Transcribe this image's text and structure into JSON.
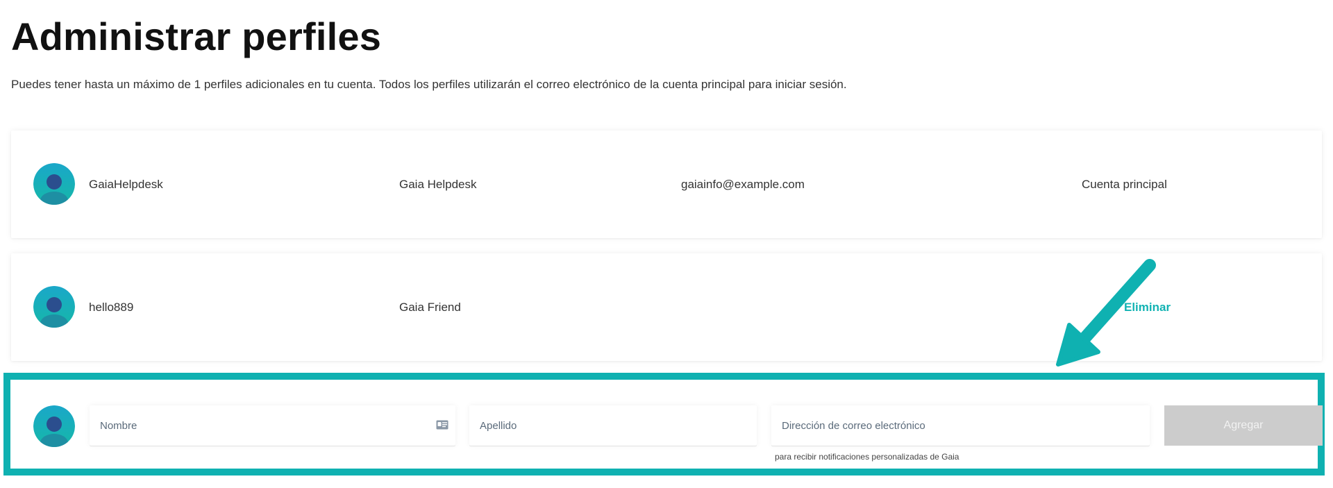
{
  "page": {
    "title": "Administrar perfiles",
    "subtitle": "Puedes tener hasta un máximo de 1 perfiles adicionales en tu cuenta. Todos los perfiles utilizarán el correo electrónico de la cuenta principal para iniciar sesión."
  },
  "profiles": [
    {
      "username": "GaiaHelpdesk",
      "display_name": "Gaia Helpdesk",
      "email": "gaiainfo@example.com",
      "status": "Cuenta principal"
    },
    {
      "username": "hello889",
      "display_name": "Gaia Friend",
      "email": "",
      "action_label": "Eliminar"
    }
  ],
  "add_profile": {
    "first_name_placeholder": "Nombre",
    "first_name_value": "",
    "last_name_placeholder": "Apellido",
    "last_name_value": "",
    "email_placeholder": "Dirección de correo electrónico",
    "email_value": "",
    "email_hint": "para recibir notificaciones personalizadas de Gaia",
    "add_button_label": "Agregar",
    "contact_card_icon": "contact-card-icon"
  },
  "colors": {
    "accent": "#0fb1b1",
    "link": "#12b3b3",
    "button_disabled": "#cccccc",
    "avatar_light": "#17b4c0",
    "avatar_dark": "#2a4f8f"
  }
}
